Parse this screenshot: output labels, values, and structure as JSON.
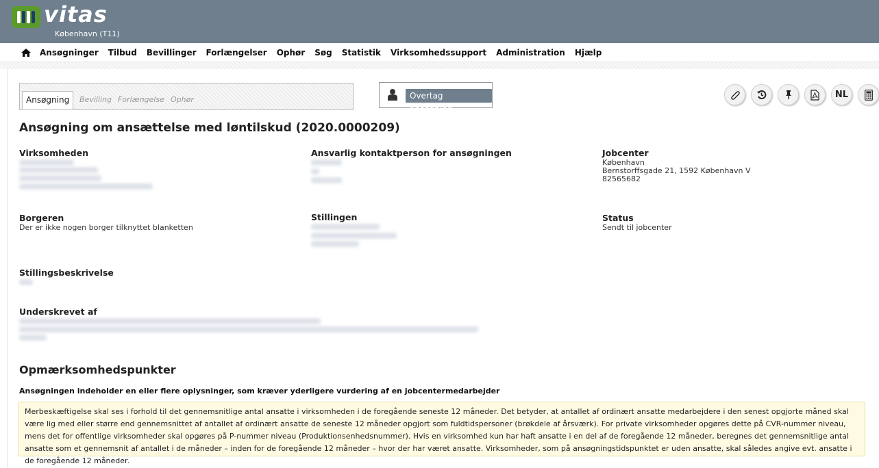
{
  "header": {
    "brand": "vitas",
    "subtitle": "København (T11)"
  },
  "nav": {
    "items": [
      "Ansøgninger",
      "Tilbud",
      "Bevillinger",
      "Forlængelser",
      "Ophør",
      "Søg",
      "Statistik",
      "Virksomhedssupport",
      "Administration",
      "Hjælp"
    ]
  },
  "tabs": [
    "Ansøgning",
    "Bevilling",
    "Forlængelse",
    "Ophør"
  ],
  "takeover_label": "Overtag ansøgning",
  "action_buttons": [
    "paperclip-icon",
    "history-icon",
    "pin-icon",
    "pdf-icon",
    "NL",
    "calculator-icon"
  ],
  "page_title": "Ansøgning om ansættelse med løntilskud (2020.0000209)",
  "fields": {
    "virksomheden": {
      "label": "Virksomheden"
    },
    "kontaktperson": {
      "label": "Ansvarlig kontaktperson for ansøgningen"
    },
    "jobcenter": {
      "label": "Jobcenter",
      "lines": [
        "København",
        "Bernstorffsgade 21, 1592 København V",
        "82565682"
      ]
    },
    "borgeren": {
      "label": "Borgeren",
      "value": "Der er ikke nogen borger tilknyttet blanketten"
    },
    "stillingen": {
      "label": "Stillingen"
    },
    "status": {
      "label": "Status",
      "value": "Sendt til jobcenter"
    },
    "stillingsbeskrivelse": {
      "label": "Stillingsbeskrivelse"
    },
    "underskrevet": {
      "label": "Underskrevet af"
    }
  },
  "opmaerksomhed": {
    "title": "Opmærksomhedspunkter",
    "heading": "Ansøgningen indeholder en eller flere oplysninger, som kræver yderligere vurdering af en jobcentermedarbejder",
    "text": "Merbeskæftigelse skal ses i forhold til det gennemsnitlige antal ansatte i virksomheden i de foregående seneste 12 måneder. Det betyder, at antallet af ordinært ansatte medarbejdere i den senest opgjorte måned skal være lig med eller større end gennemsnittet af antallet af ordinært ansatte de seneste 12 måneder opgjort som fuldtidspersoner (brøkdele af årsværk). For private virksomheder opgøres dette på CVR-nummer niveau, mens det for offentlige virksomheder skal opgøres på P-nummer niveau (Produktionsenhedsnummer). Hvis en virksomhed kun har haft ansatte i en del af de foregående 12 måneder, beregnes det gennemsnitlige antal ansatte som et gennemsnit af antallet i de måneder – inden for de foregående 12 måneder – hvor der har været ansatte. Virksomheder, som på ansøgningstidspunktet er uden ansatte, skal således angive evt. ansatte i de foregående 12 måneder."
  }
}
